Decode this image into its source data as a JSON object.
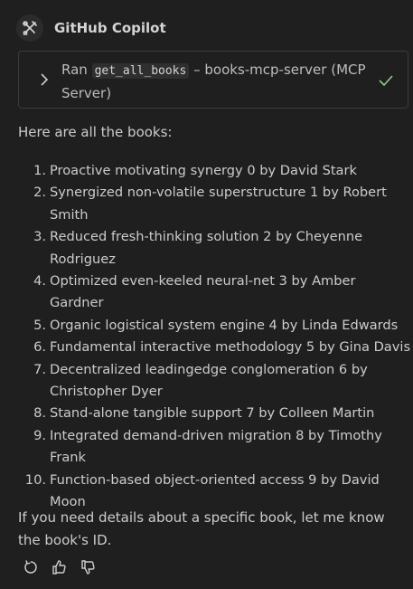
{
  "agent": {
    "name": "GitHub Copilot",
    "icon": "tools-icon"
  },
  "tool_call": {
    "prefix": "Ran",
    "tool_name": "get_all_books",
    "suffix": "– books-mcp-server (MCP Server)",
    "status": "success",
    "check_color": "#89d185"
  },
  "response": {
    "intro": "Here are all the books:",
    "books": [
      {
        "num": "1.",
        "text": "Proactive motivating synergy 0 by David Stark"
      },
      {
        "num": "2.",
        "text": "Synergized non-volatile superstructure 1 by Robert Smith"
      },
      {
        "num": "3.",
        "text": "Reduced fresh-thinking solution 2 by Cheyenne Rodriguez"
      },
      {
        "num": "4.",
        "text": "Optimized even-keeled neural-net 3 by Amber Gardner"
      },
      {
        "num": "5.",
        "text": "Organic logistical system engine 4 by Linda Edwards"
      },
      {
        "num": "6.",
        "text": "Fundamental interactive methodology 5 by Gina Davis"
      },
      {
        "num": "7.",
        "text": "Decentralized leadingedge conglomeration 6 by Christopher Dyer"
      },
      {
        "num": "8.",
        "text": "Stand-alone tangible support 7 by Colleen Martin"
      },
      {
        "num": "9.",
        "text": "Integrated demand-driven migration 8 by Timothy Frank"
      },
      {
        "num": "10.",
        "text": "Function-based object-oriented access 9 by David Moon"
      }
    ],
    "outro": "If you need details about a specific book, let me know the book's ID."
  },
  "actions": [
    {
      "name": "retry-icon"
    },
    {
      "name": "thumbs-up-icon"
    },
    {
      "name": "thumbs-down-icon"
    }
  ]
}
